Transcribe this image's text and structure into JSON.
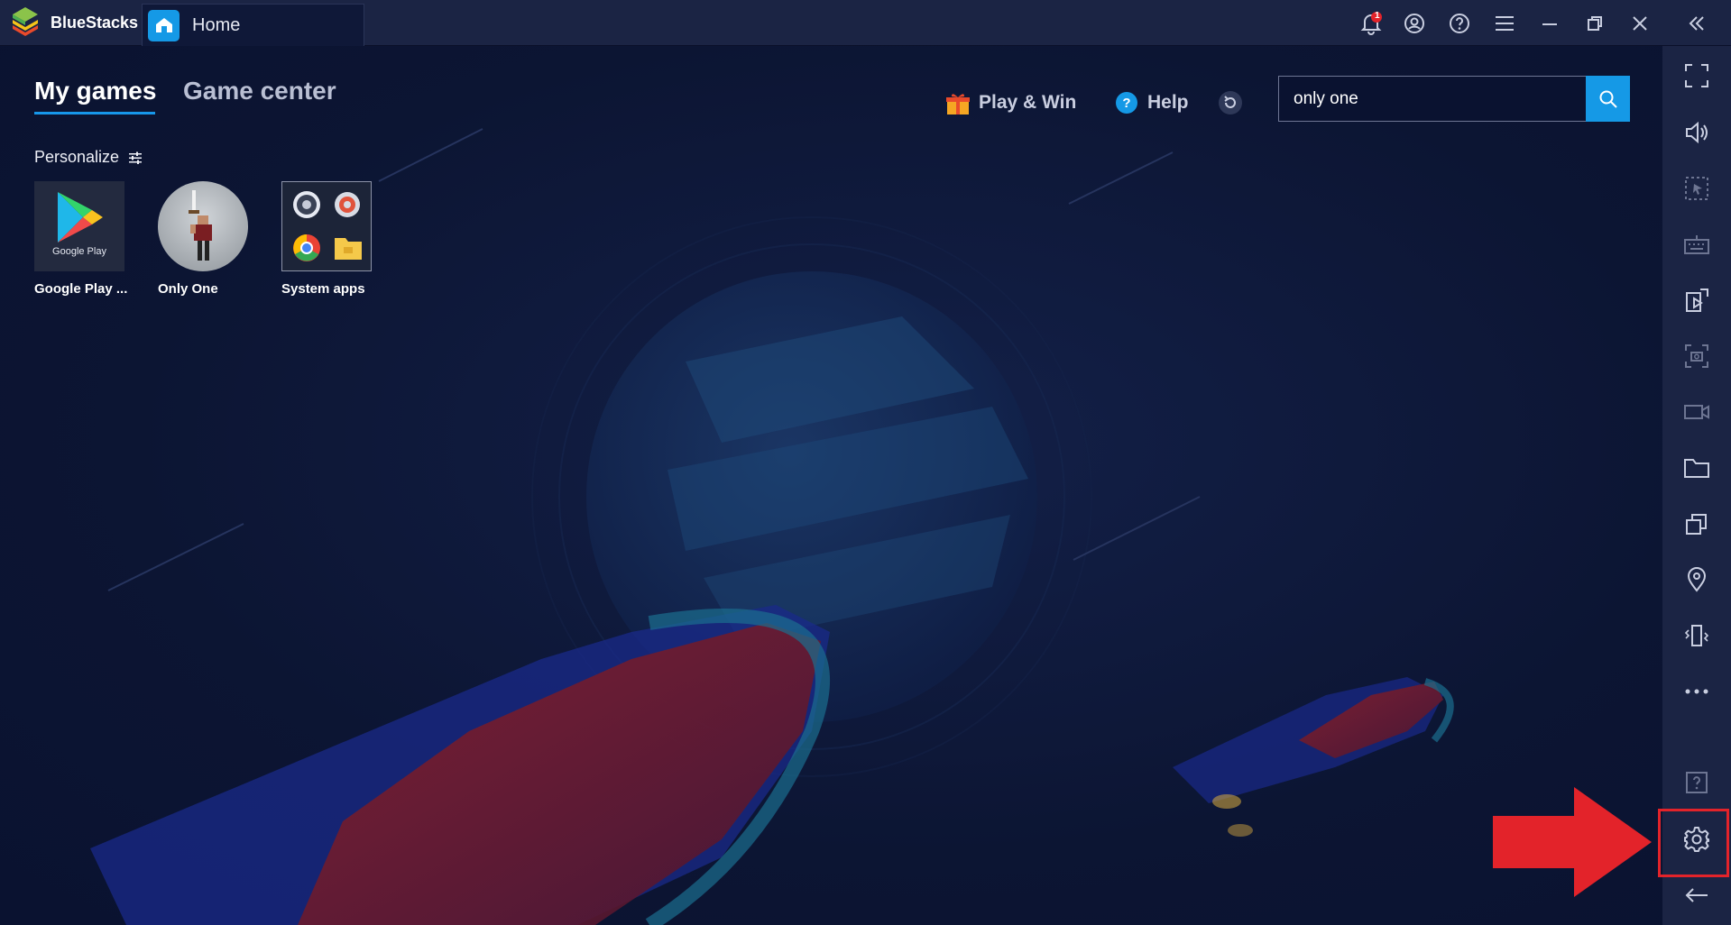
{
  "titlebar": {
    "app_name": "BlueStacks",
    "tab_label": "Home",
    "notification_count": "1"
  },
  "main": {
    "tabs": [
      {
        "label": "My games",
        "active": true
      },
      {
        "label": "Game center",
        "active": false
      }
    ],
    "actions": {
      "play_win": "Play & Win",
      "help": "Help"
    },
    "search": {
      "value": "only one",
      "placeholder": ""
    },
    "personalize_label": "Personalize",
    "apps": [
      {
        "label": "Google Play ...",
        "icon_caption": "Google Play"
      },
      {
        "label": "Only One"
      },
      {
        "label": "System apps"
      }
    ]
  },
  "colors": {
    "accent": "#1599e6",
    "highlight": "#e3232a",
    "sidebar": "#1b2444",
    "background": "#0c1533"
  },
  "sidebar": {
    "items": [
      "fullscreen-icon",
      "volume-icon",
      "select-area-icon",
      "keyboard-icon",
      "install-apk-icon",
      "screenshot-icon",
      "record-icon",
      "folder-icon",
      "multi-instance-icon",
      "location-icon",
      "shake-icon",
      "more-icon",
      "help-icon",
      "settings-icon",
      "back-icon"
    ]
  }
}
